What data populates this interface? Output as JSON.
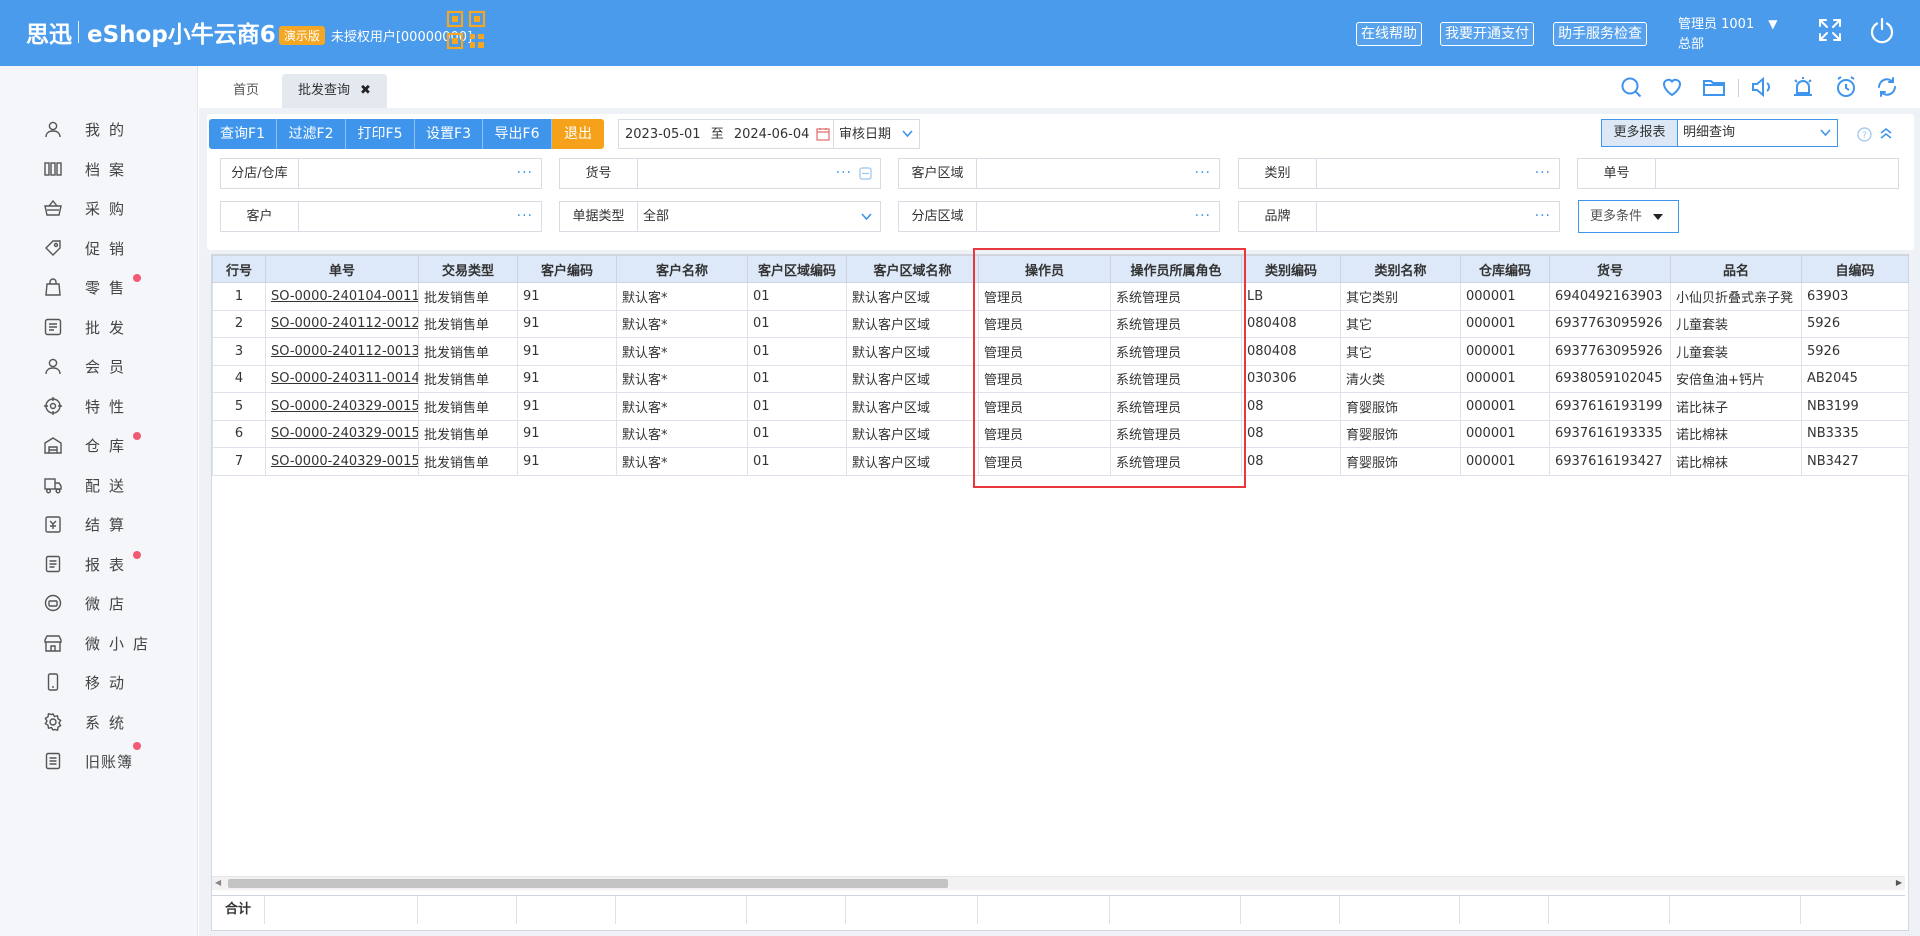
{
  "topbar": {
    "brand_name": "思迅",
    "brand_product": "eShop小牛云商6",
    "demo_badge": "演示版",
    "license_text": "未授权用户[00000000]",
    "buttons": [
      "在线帮助",
      "我要开通支付",
      "助手服务检查"
    ],
    "user": "管理员 1001",
    "user_caret": "▼",
    "branch": "总部"
  },
  "sidebar": {
    "items": [
      {
        "label": "我的",
        "icon": "user-icon",
        "dot": false
      },
      {
        "label": "档案",
        "icon": "archive-icon",
        "dot": false
      },
      {
        "label": "采购",
        "icon": "basket-icon",
        "dot": false
      },
      {
        "label": "促销",
        "icon": "tag-icon",
        "dot": false
      },
      {
        "label": "零售",
        "icon": "shopping-bag-icon",
        "dot": true
      },
      {
        "label": "批发",
        "icon": "wholesale-icon",
        "dot": false
      },
      {
        "label": "会员",
        "icon": "member-icon",
        "dot": false
      },
      {
        "label": "特性",
        "icon": "feature-icon",
        "dot": false
      },
      {
        "label": "仓库",
        "icon": "warehouse-icon",
        "dot": true
      },
      {
        "label": "配送",
        "icon": "truck-icon",
        "dot": false
      },
      {
        "label": "结算",
        "icon": "settlement-icon",
        "dot": false
      },
      {
        "label": "报表",
        "icon": "report-icon",
        "dot": true
      },
      {
        "label": "微店",
        "icon": "micro-shop-icon",
        "dot": false
      },
      {
        "label": "微小店",
        "icon": "store-icon",
        "dot": false
      },
      {
        "label": "移动",
        "icon": "mobile-icon",
        "dot": false
      },
      {
        "label": "系统",
        "icon": "settings-icon",
        "dot": false
      },
      {
        "label": "旧账簿",
        "icon": "ledger-icon",
        "dot": true
      }
    ]
  },
  "tabs": {
    "home": "首页",
    "active": "批发查询",
    "close": "✖"
  },
  "toolbar": {
    "buttons": [
      "查询F1",
      "过滤F2",
      "打印F5",
      "设置F3",
      "导出F6",
      "退出"
    ],
    "date_from": "2023-05-01",
    "date_to_sep": "至",
    "date_to": "2024-06-04",
    "date_type": "审核日期",
    "more_reports_label": "更多报表",
    "report_mode": "明细查询"
  },
  "filters": {
    "branch_label": "分店/仓库",
    "goods_no_label": "货号",
    "customer_area_label": "客户区域",
    "category_label": "类别",
    "doc_no_label": "单号",
    "customer_label": "客户",
    "doc_type_label": "单据类型",
    "doc_type_value": "全部",
    "branch_area_label": "分店区域",
    "brand_label": "品牌",
    "more_conditions": "更多条件",
    "dots": "···"
  },
  "table": {
    "columns": [
      "行号",
      "单号",
      "交易类型",
      "客户编码",
      "客户名称",
      "客户区域编码",
      "客户区域名称",
      "操作员",
      "操作员所属角色",
      "类别编码",
      "类别名称",
      "仓库编码",
      "货号",
      "品名",
      "自编码"
    ],
    "rows": [
      [
        "1",
        "SO-0000-240104-0011",
        "批发销售单",
        "91",
        "默认客*",
        "01",
        "默认客户区域",
        "管理员",
        "系统管理员",
        "LB",
        "其它类别",
        "000001",
        "6940492163903",
        "小仙贝折叠式亲子凳",
        "63903"
      ],
      [
        "2",
        "SO-0000-240112-0012",
        "批发销售单",
        "91",
        "默认客*",
        "01",
        "默认客户区域",
        "管理员",
        "系统管理员",
        "080408",
        "其它",
        "000001",
        "6937763095926",
        "儿童套装",
        "5926"
      ],
      [
        "3",
        "SO-0000-240112-0013",
        "批发销售单",
        "91",
        "默认客*",
        "01",
        "默认客户区域",
        "管理员",
        "系统管理员",
        "080408",
        "其它",
        "000001",
        "6937763095926",
        "儿童套装",
        "5926"
      ],
      [
        "4",
        "SO-0000-240311-0014",
        "批发销售单",
        "91",
        "默认客*",
        "01",
        "默认客户区域",
        "管理员",
        "系统管理员",
        "030306",
        "清火类",
        "000001",
        "6938059102045",
        "安倍鱼油+钙片",
        "AB2045"
      ],
      [
        "5",
        "SO-0000-240329-0015",
        "批发销售单",
        "91",
        "默认客*",
        "01",
        "默认客户区域",
        "管理员",
        "系统管理员",
        "08",
        "育婴服饰",
        "000001",
        "6937616193199",
        "诺比袜子",
        "NB3199"
      ],
      [
        "6",
        "SO-0000-240329-0015",
        "批发销售单",
        "91",
        "默认客*",
        "01",
        "默认客户区域",
        "管理员",
        "系统管理员",
        "08",
        "育婴服饰",
        "000001",
        "6937616193335",
        "诺比棉袜",
        "NB3335"
      ],
      [
        "7",
        "SO-0000-240329-0015",
        "批发销售单",
        "91",
        "默认客*",
        "01",
        "默认客户区域",
        "管理员",
        "系统管理员",
        "08",
        "育婴服饰",
        "000001",
        "6937616193427",
        "诺比棉袜",
        "NB3427"
      ]
    ],
    "total_label": "合计"
  },
  "colors": {
    "topbar": "#4a9bec",
    "accent": "#3f95ec",
    "exit": "#f6a11a",
    "highlight_box": "#e8383d",
    "header_bg": "#dde9f8"
  }
}
